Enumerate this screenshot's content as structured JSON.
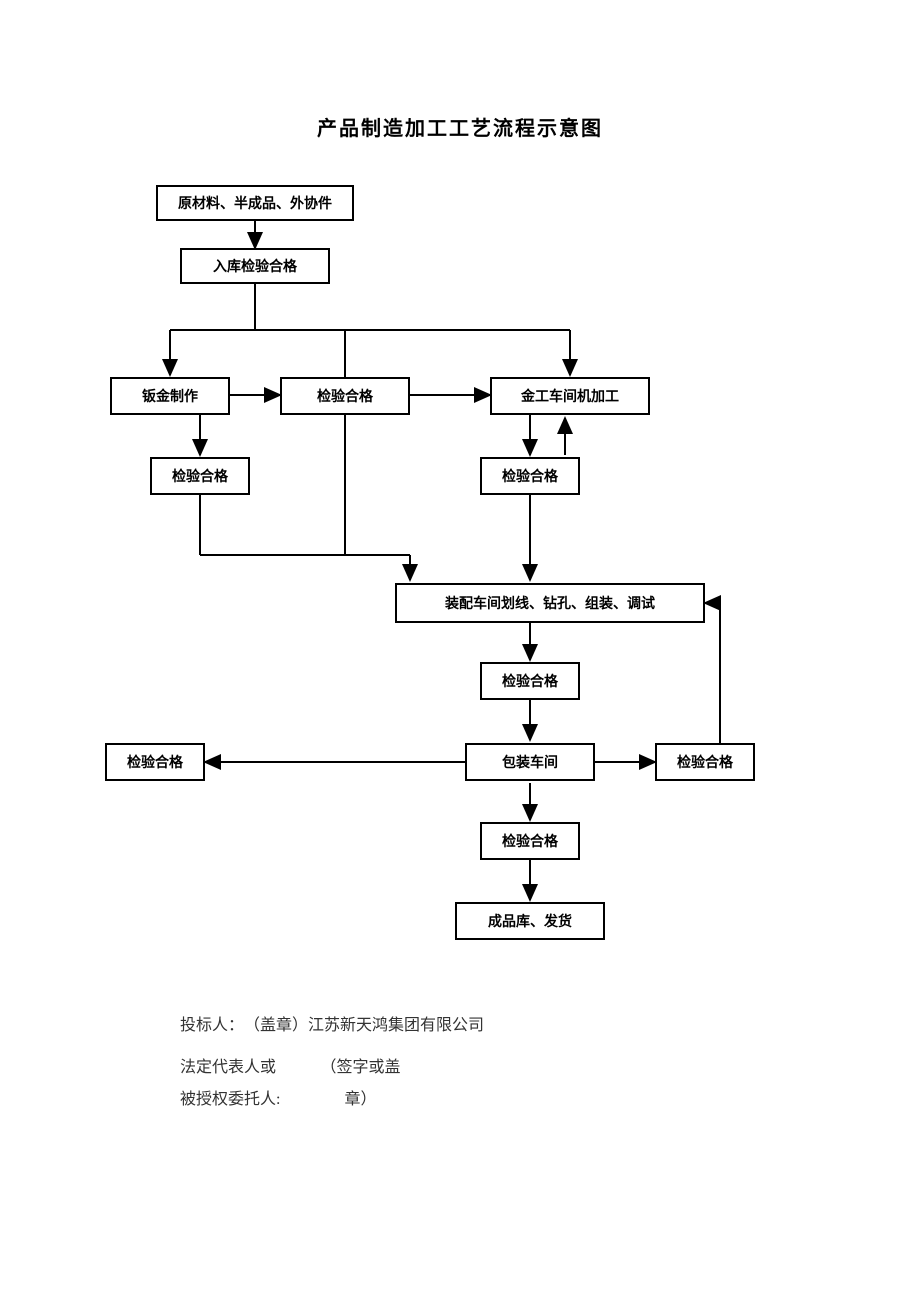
{
  "title": "产品制造加工工艺流程示意图",
  "nodes": {
    "n1": "原材料、半成品、外协件",
    "n2": "入库检验合格",
    "n3": "钣金制作",
    "n4": "检验合格",
    "n5": "金工车间机加工",
    "n6": "检验合格",
    "n7": "检验合格",
    "n8": "装配车间划线、钻孔、组装、调试",
    "n9": "检验合格",
    "n10": "检验合格",
    "n11": "包装车间",
    "n12": "检验合格",
    "n13": "检验合格",
    "n14": "成品库、发货"
  },
  "footer": {
    "bidder_label": "投标人：",
    "bidder_value": "（盖章）江苏新天鸿集团有限公司",
    "rep_line1": "法定代表人或",
    "rep_line2": "被授权委托人:",
    "sign_line1": "（签字或盖",
    "sign_line2": "章）"
  }
}
